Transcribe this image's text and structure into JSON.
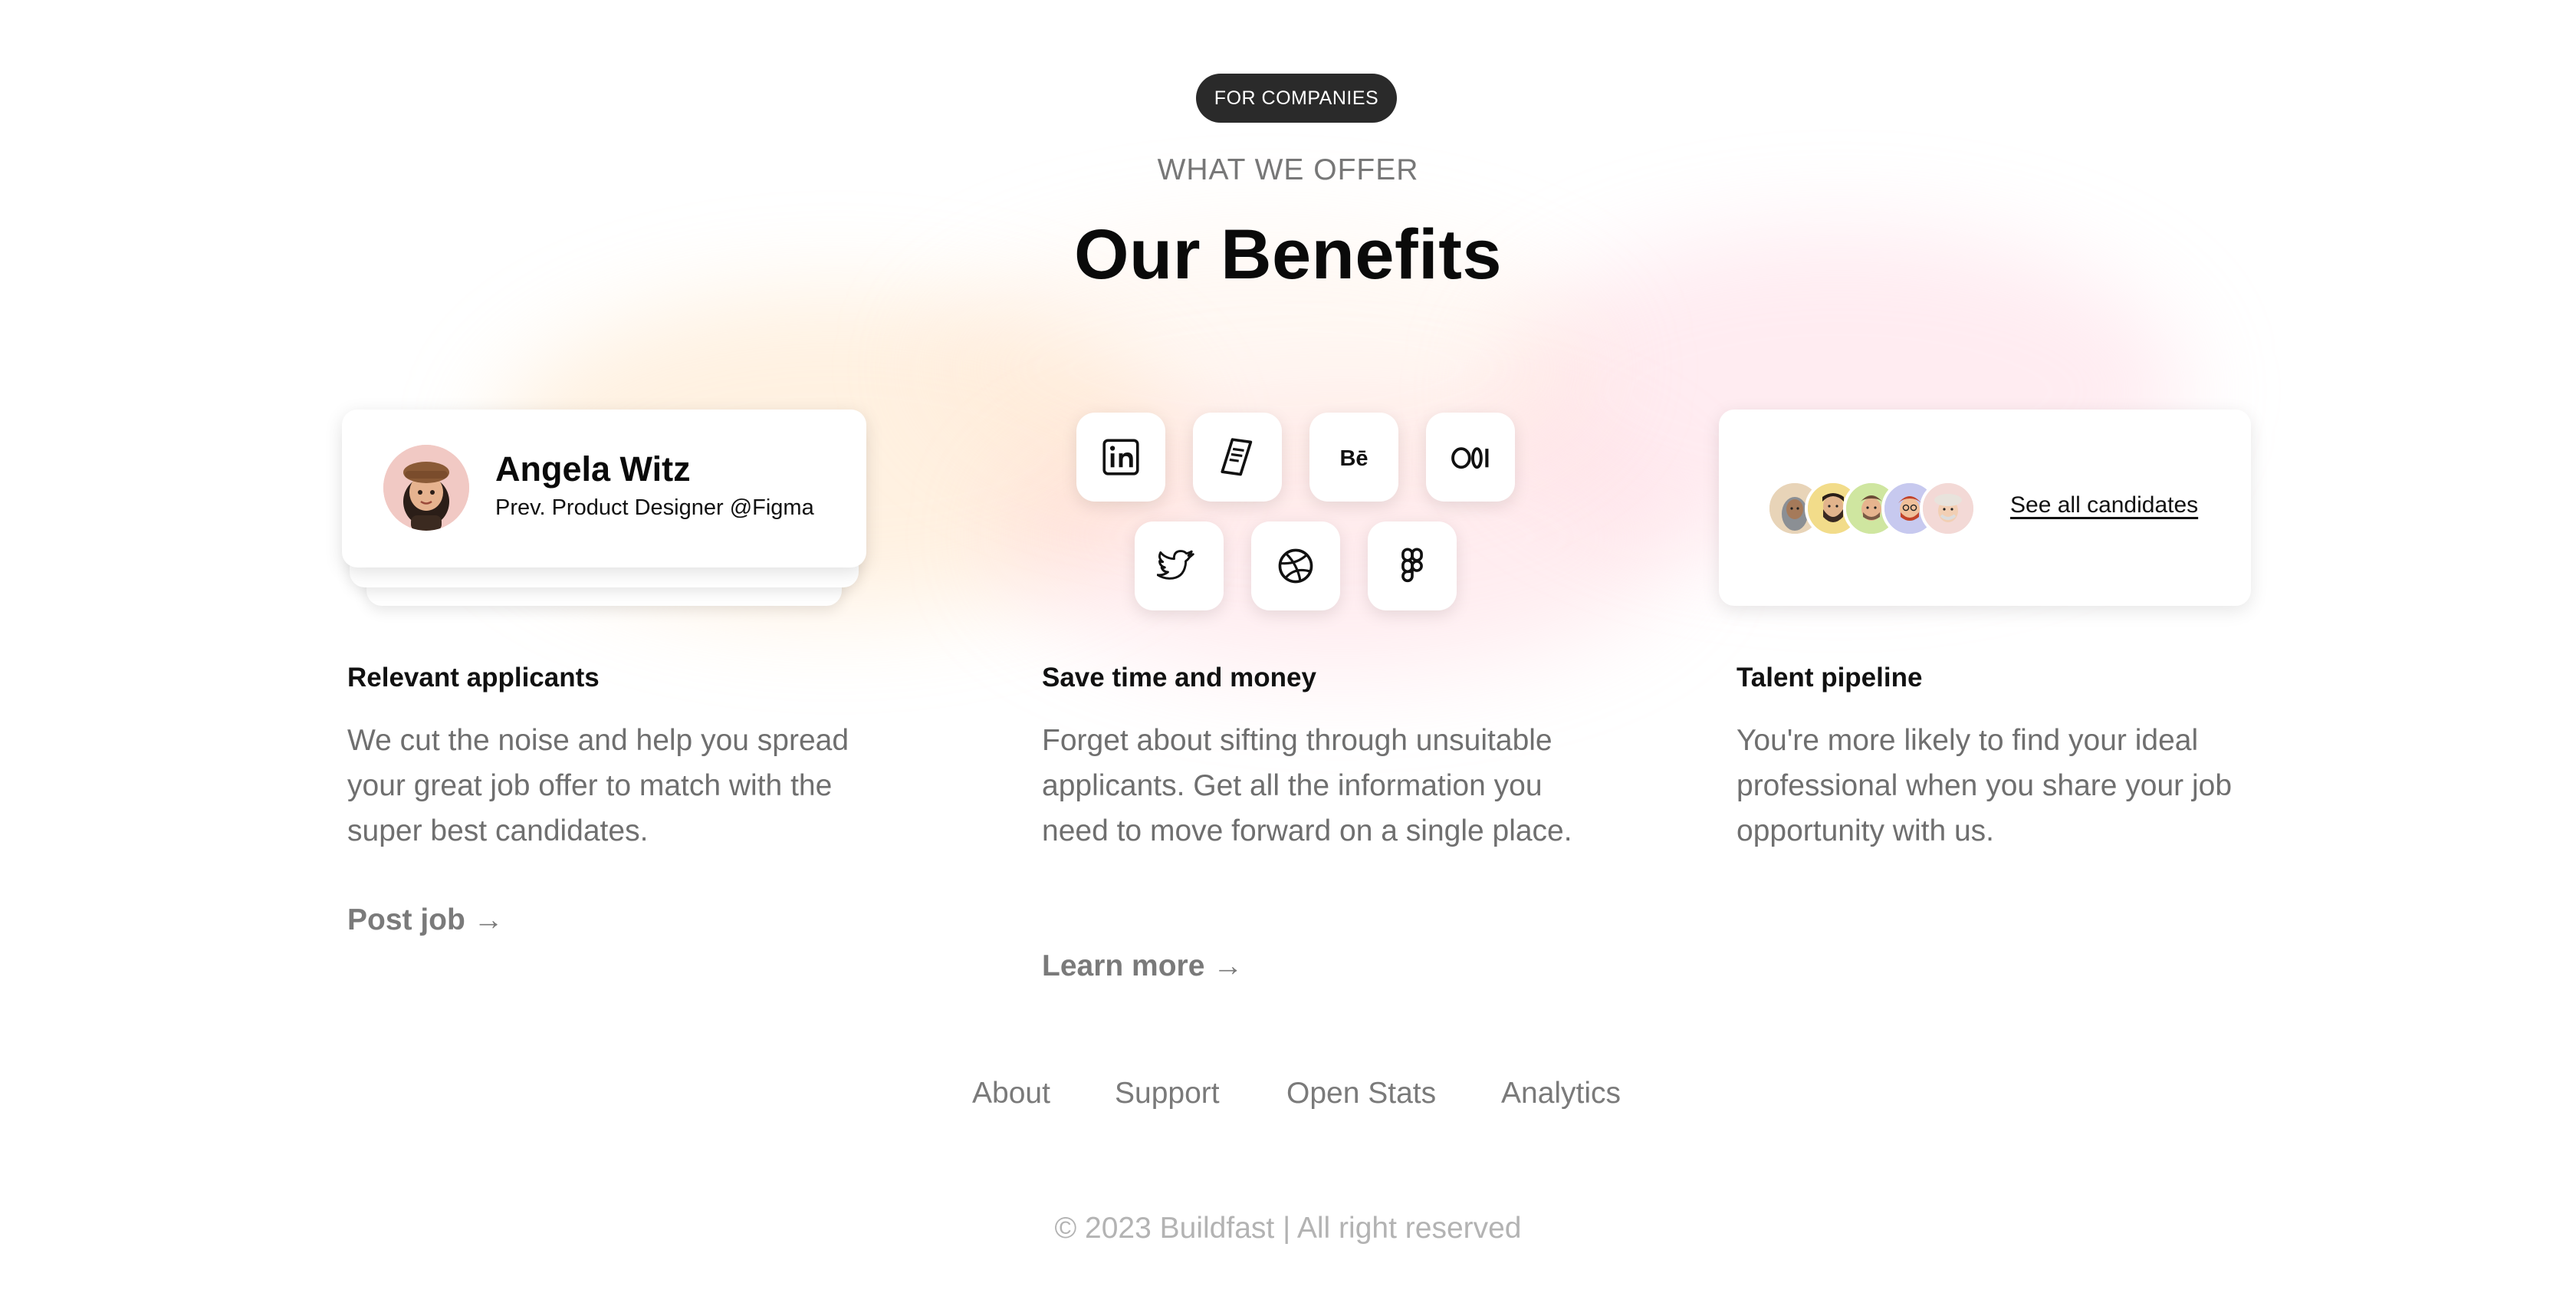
{
  "badge": "FOR COMPANIES",
  "eyebrow": "WHAT WE OFFER",
  "heading": "Our Benefits",
  "profile": {
    "name": "Angela Witz",
    "role": "Prev. Product Designer @Figma"
  },
  "social_icons": [
    "linkedin-icon",
    "document-icon",
    "behance-icon",
    "medium-icon",
    "twitter-icon",
    "dribbble-icon",
    "figma-icon"
  ],
  "candidates": {
    "avatars": [
      "candidate-avatar-1",
      "candidate-avatar-2",
      "candidate-avatar-3",
      "candidate-avatar-4",
      "candidate-avatar-5"
    ],
    "link": "See all candidates"
  },
  "columns": [
    {
      "title": "Relevant applicants",
      "body": "We cut the noise and help you spread your great job offer to match with the super best candidates.",
      "link": "Post job →"
    },
    {
      "title": "Save time and money",
      "body": "Forget about sifting through unsuitable applicants. Get all the information you need to move forward on a single place.",
      "link": "Learn more →"
    },
    {
      "title": "Talent pipeline",
      "body": "You're more likely to find your ideal professional when you share your job opportunity with us.",
      "link": ""
    }
  ],
  "footer": {
    "links": [
      "About",
      "Support",
      "Open Stats",
      "Analytics"
    ],
    "copyright": "© 2023 Buildfast | All right reserved"
  },
  "colors": {
    "badge_bg": "#2a2a2a",
    "text_muted": "#6f6f6f",
    "heading": "#0a0a0a"
  }
}
